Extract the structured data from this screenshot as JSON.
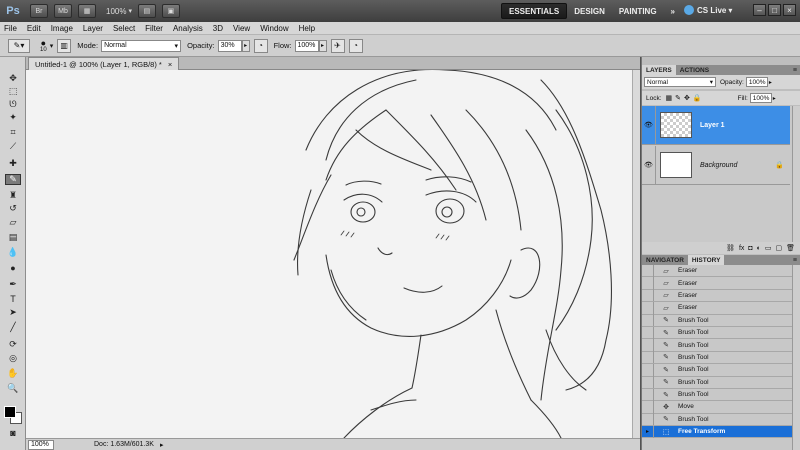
{
  "appbar": {
    "logo": "Ps",
    "bridge": "Br",
    "minibridge": "Mb",
    "zoom": "100%",
    "workspaces": [
      "ESSENTIALS",
      "DESIGN",
      "PAINTING"
    ],
    "more": "»",
    "cslive": "CS Live",
    "window_controls": [
      "–",
      "□",
      "×"
    ]
  },
  "menu": [
    "File",
    "Edit",
    "Image",
    "Layer",
    "Select",
    "Filter",
    "Analysis",
    "3D",
    "View",
    "Window",
    "Help"
  ],
  "options": {
    "brush_size": "10",
    "mode_label": "Mode:",
    "mode_value": "Normal",
    "opacity_label": "Opacity:",
    "opacity_value": "30%",
    "flow_label": "Flow:",
    "flow_value": "100%"
  },
  "document": {
    "tab_title": "Untitled-1 @ 100% (Layer 1, RGB/8) *",
    "tab_close": "×"
  },
  "status": {
    "zoom": "100%",
    "doc": "Doc: 1.63M/601.3K",
    "arrow": "▸"
  },
  "layers_panel": {
    "tabs": [
      "LAYERS",
      "ACTIONS"
    ],
    "blend_mode": "Normal",
    "opacity_label": "Opacity:",
    "opacity_value": "100%",
    "lock_label": "Lock:",
    "fill_label": "Fill:",
    "fill_value": "100%",
    "layers": [
      {
        "name": "Layer 1",
        "selected": true
      },
      {
        "name": "Background",
        "selected": false
      }
    ]
  },
  "history_panel": {
    "tabs": [
      "NAVIGATOR",
      "HISTORY"
    ],
    "items": [
      {
        "name": "Eraser",
        "icon": "eraser-icon"
      },
      {
        "name": "Eraser",
        "icon": "eraser-icon"
      },
      {
        "name": "Eraser",
        "icon": "eraser-icon"
      },
      {
        "name": "Eraser",
        "icon": "eraser-icon"
      },
      {
        "name": "Brush Tool",
        "icon": "brush-icon"
      },
      {
        "name": "Brush Tool",
        "icon": "brush-icon"
      },
      {
        "name": "Brush Tool",
        "icon": "brush-icon"
      },
      {
        "name": "Brush Tool",
        "icon": "brush-icon"
      },
      {
        "name": "Brush Tool",
        "icon": "brush-icon"
      },
      {
        "name": "Brush Tool",
        "icon": "brush-icon"
      },
      {
        "name": "Brush Tool",
        "icon": "brush-icon"
      },
      {
        "name": "Move",
        "icon": "move-icon"
      },
      {
        "name": "Brush Tool",
        "icon": "brush-icon"
      },
      {
        "name": "Free Transform",
        "icon": "transform-icon",
        "current": true
      }
    ]
  },
  "colors": {
    "selection": "#3d8ee6",
    "history_current": "#1a6fd7",
    "foreground": "#000000",
    "background": "#ffffff"
  }
}
